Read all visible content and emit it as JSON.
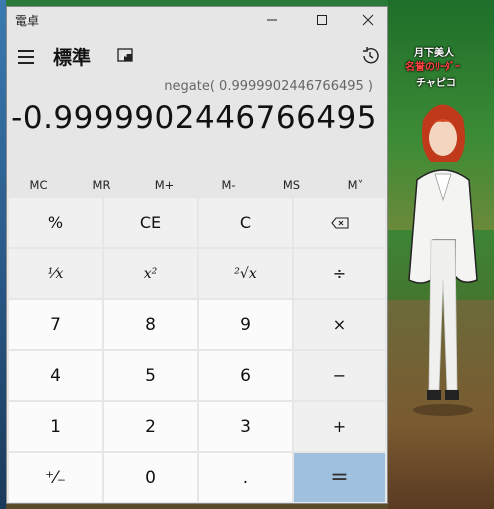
{
  "window": {
    "title": "電卓"
  },
  "header": {
    "mode": "標準"
  },
  "display": {
    "expression": "negate( 0.9999902446766495 )",
    "value": "-0.9999902446766495"
  },
  "memory": [
    "MC",
    "MR",
    "M+",
    "M-",
    "MS",
    "M˅"
  ],
  "keys": {
    "percent": "%",
    "ce": "CE",
    "c": "C",
    "square": "x²",
    "sqrt": "²√x",
    "reciprocal": "¹⁄x",
    "divide": "÷",
    "multiply": "×",
    "minus": "−",
    "plus": "+",
    "equals": "=",
    "negate": "⁺⁄₋",
    "dot": ".",
    "n0": "0",
    "n1": "1",
    "n2": "2",
    "n3": "3",
    "n4": "4",
    "n5": "5",
    "n6": "6",
    "n7": "7",
    "n8": "8",
    "n9": "9"
  },
  "game": {
    "char_name": "月下美人",
    "char_guild": "名誉のﾘｰﾀﾞｰ",
    "char_sub": "チャピコ"
  },
  "colors": {
    "equals_bg": "#9fc1dd",
    "panel_bg": "#e6e6e6",
    "guild_text": "#ff4040"
  }
}
